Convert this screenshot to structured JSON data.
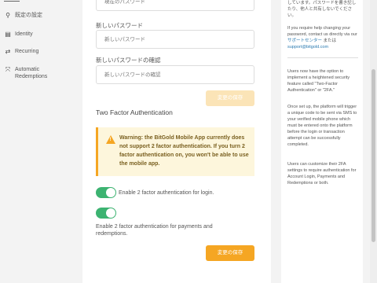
{
  "sidebar": {
    "items": [
      {
        "icon": "sliders-icon",
        "glyph": "⚲",
        "label": "既定の設定"
      },
      {
        "icon": "id-card-icon",
        "glyph": "▤",
        "label": "Identity"
      },
      {
        "icon": "recurring-icon",
        "glyph": "⇄",
        "label": "Recurring"
      },
      {
        "icon": "redemption-icon",
        "glyph": "⤧",
        "label": "Automatic Redemptions"
      }
    ]
  },
  "password": {
    "current_placeholder": "現在のパスワード",
    "new_label": "新しいパスワード",
    "new_placeholder": "新しいパスワード",
    "confirm_label": "新しいパスワードの確認",
    "confirm_placeholder": "新しいパスワードの確認",
    "save_label": "変更の保存"
  },
  "two_factor": {
    "title": "Two Factor Authentication",
    "warning": "Warning: the BitGold Mobile App currently does not support 2 factor authentication. If you turn 2 factor authentication on, you won't be able to use the mobile app.",
    "toggle_login_label": "Enable 2 factor authentication for login.",
    "toggle_login_on": true,
    "toggle_payments_label": "Enable 2 factor authentication for payments and redemptions.",
    "toggle_payments_on": true,
    "save_label": "変更の保存"
  },
  "info": {
    "top_text": "しています。パスワードを書き記したり、他人と共有しないでください。",
    "help_text_before": "If you require help changing your password, contact us directly via our ",
    "help_link": "サポートセンター",
    "help_text_mid": " または ",
    "help_email": "support@bitgold.com",
    "para1": "Users now have the option to implement a heightened security feature called \"Two-Factor Authentication\" or \"2FA.\"",
    "para2": "Once set up, the platform will trigger a unique code to be sent via SMS to your verified mobile phone which must be entered onto the platform before the login or transaction attempt can be successfully completed.",
    "para3": "Users can customize their 2FA settings to require authentication for Account Login, Payments and Redemptions or both."
  },
  "colors": {
    "accent": "#f5a623",
    "toggle_on": "#3cb371",
    "link": "#2a7ab0",
    "warning_bg": "#fdf6dc"
  }
}
